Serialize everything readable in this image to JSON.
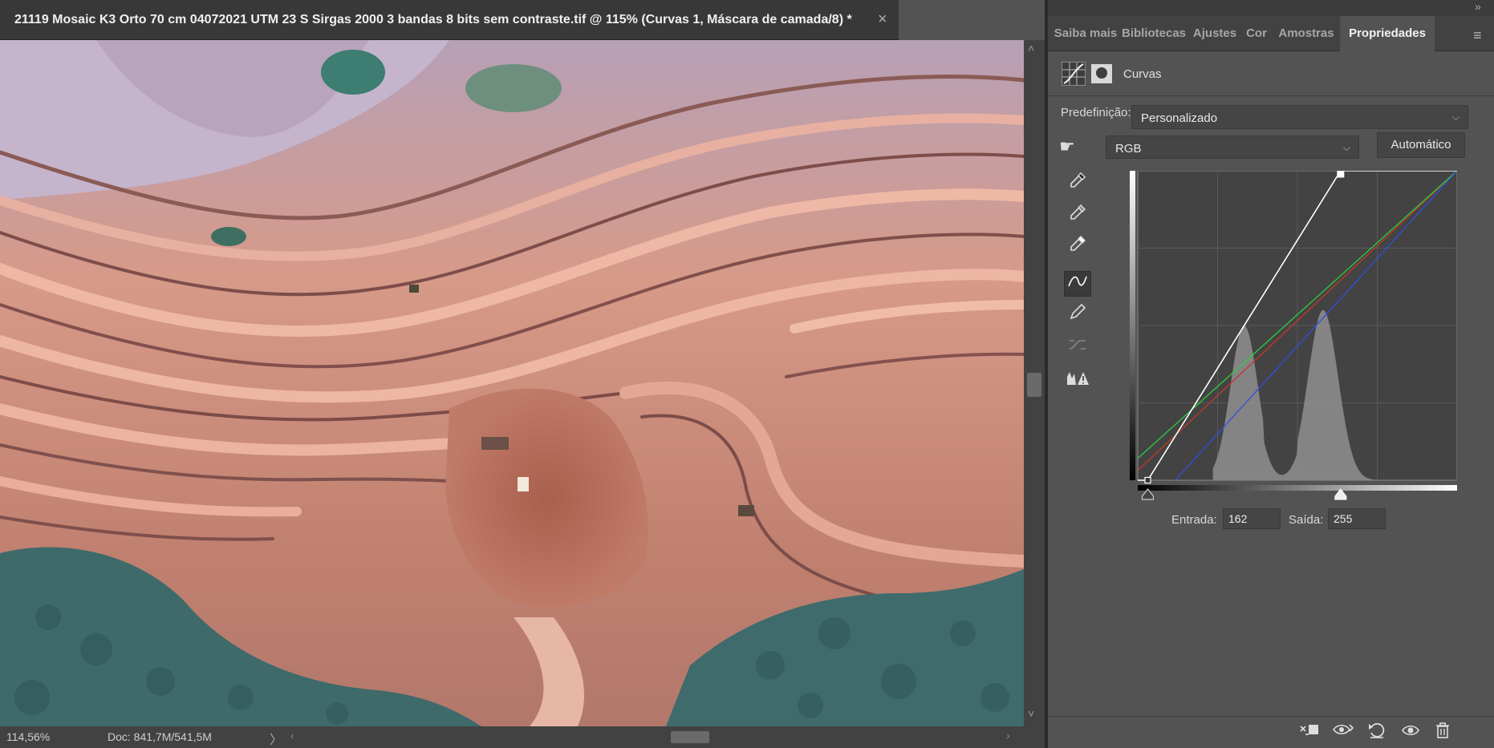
{
  "document": {
    "title": "21119 Mosaic K3 Orto 70 cm 04072021 UTM 23 S Sirgas 2000 3 bandas 8 bits sem contraste.tif @ 115% (Curvas 1, Máscara de camada/8) *",
    "close_glyph": "×"
  },
  "status": {
    "zoom": "114,56%",
    "doc_info": "Doc: 841,7M/541,5M",
    "arrow": "〉"
  },
  "panel": {
    "tabs": [
      {
        "label": "Saiba mais"
      },
      {
        "label": "Bibliotecas"
      },
      {
        "label": "Ajustes"
      },
      {
        "label": "Cor"
      },
      {
        "label": "Amostras"
      },
      {
        "label": "Propriedades"
      }
    ],
    "active_tab": "Propriedades",
    "properties_title": "Curvas",
    "preset_label": "Predefinição:",
    "preset_value": "Personalizado",
    "channel_value": "RGB",
    "auto_label": "Automático",
    "input_label": "Entrada:",
    "input_value": "162",
    "output_label": "Saída:",
    "output_value": "255"
  },
  "curve": {
    "black_point_input": 8,
    "white_point_input": 162,
    "rgb_points": [
      [
        0,
        0
      ],
      [
        8,
        0
      ],
      [
        162,
        255
      ],
      [
        255,
        255
      ]
    ],
    "red_points": [
      [
        0,
        8
      ],
      [
        255,
        255
      ]
    ],
    "green_points": [
      [
        0,
        18
      ],
      [
        255,
        255
      ]
    ],
    "blue_points": [
      [
        30,
        0
      ],
      [
        255,
        255
      ]
    ]
  },
  "colors": {
    "accent_rgb_curve": "#ffffff",
    "red_curve": "#c0392b",
    "green_curve": "#2ecc40",
    "blue_curve": "#3050e0"
  },
  "icons": [
    "close-icon",
    "hand-target-icon",
    "eyedropper-black-icon",
    "eyedropper-gray-icon",
    "eyedropper-white-icon",
    "curve-point-icon",
    "pencil-icon",
    "smooth-icon",
    "clipping-warning-icon",
    "clip-to-layer-icon",
    "view-previous-icon",
    "reset-icon",
    "visibility-icon",
    "trash-icon"
  ]
}
